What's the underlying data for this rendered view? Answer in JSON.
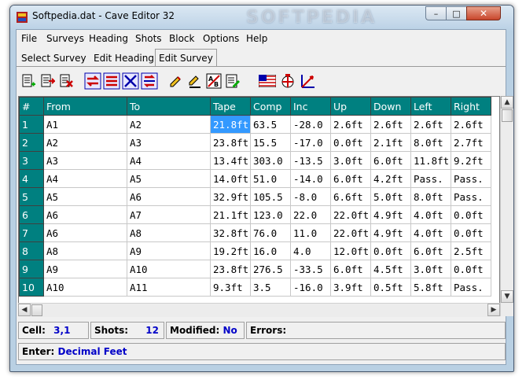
{
  "window": {
    "title": "Softpedia.dat - Cave Editor 32",
    "watermark": "SOFTPEDIA",
    "min": "–",
    "max": "□",
    "close": "✕"
  },
  "menu": [
    "File",
    "Surveys",
    "Heading",
    "Shots",
    "Block",
    "Options",
    "Help"
  ],
  "tabs": [
    {
      "label": "Select Survey",
      "active": false
    },
    {
      "label": "Edit Heading",
      "active": false
    },
    {
      "label": "Edit Survey",
      "active": true
    }
  ],
  "toolbar_icons": [
    "add-shot-icon",
    "insert-shot-icon",
    "delete-shot-icon",
    "reverse-shot-icon",
    "swap-stations-icon",
    "reverse-all-icon",
    "renumber-icon",
    "edit-icon",
    "edit-lrud-icon",
    "ab-icon",
    "notes-icon",
    "units-flag-icon",
    "compass-icon",
    "angles-icon"
  ],
  "table": {
    "headers": [
      "#",
      "From",
      "To",
      "Tape",
      "Comp",
      "Inc",
      "Up",
      "Down",
      "Left",
      "Right"
    ],
    "rows": [
      [
        "1",
        "A1",
        "A2",
        "21.8ft",
        "63.5",
        "-28.0",
        "2.6ft",
        "2.6ft",
        "2.6ft",
        "2.6ft"
      ],
      [
        "2",
        "A2",
        "A3",
        "23.8ft",
        "15.5",
        "-17.0",
        "0.0ft",
        "2.1ft",
        "8.0ft",
        "2.7ft"
      ],
      [
        "3",
        "A3",
        "A4",
        "13.4ft",
        "303.0",
        "-13.5",
        "3.0ft",
        "6.0ft",
        "11.8ft",
        "9.2ft"
      ],
      [
        "4",
        "A4",
        "A5",
        "14.0ft",
        "51.0",
        "-14.0",
        "6.0ft",
        "4.2ft",
        "Pass.",
        "Pass."
      ],
      [
        "5",
        "A5",
        "A6",
        "32.9ft",
        "105.5",
        "-8.0",
        "6.6ft",
        "5.0ft",
        "8.0ft",
        "Pass."
      ],
      [
        "6",
        "A6",
        "A7",
        "21.1ft",
        "123.0",
        "22.0",
        "22.0ft",
        "4.9ft",
        "4.0ft",
        "0.0ft"
      ],
      [
        "7",
        "A6",
        "A8",
        "32.8ft",
        "76.0",
        "11.0",
        "22.0ft",
        "4.9ft",
        "4.0ft",
        "0.0ft"
      ],
      [
        "8",
        "A8",
        "A9",
        "19.2ft",
        "16.0",
        "4.0",
        "12.0ft",
        "0.0ft",
        "6.0ft",
        "2.5ft"
      ],
      [
        "9",
        "A9",
        "A10",
        "23.8ft",
        "276.5",
        "-33.5",
        "6.0ft",
        "4.5ft",
        "3.0ft",
        "0.0ft"
      ],
      [
        "10",
        "A10",
        "A11",
        "9.3ft",
        "3.5",
        "-16.0",
        "3.9ft",
        "0.5ft",
        "5.8ft",
        "Pass."
      ]
    ],
    "selected": {
      "row": 0,
      "col": 3
    }
  },
  "status": {
    "cell_label": "Cell:",
    "cell_value": "3,1",
    "shots_label": "Shots:",
    "shots_value": "12",
    "modified_label": "Modified:",
    "modified_value": "No",
    "errors_label": "Errors:",
    "enter_label": "Enter:",
    "enter_value": "Decimal Feet"
  }
}
